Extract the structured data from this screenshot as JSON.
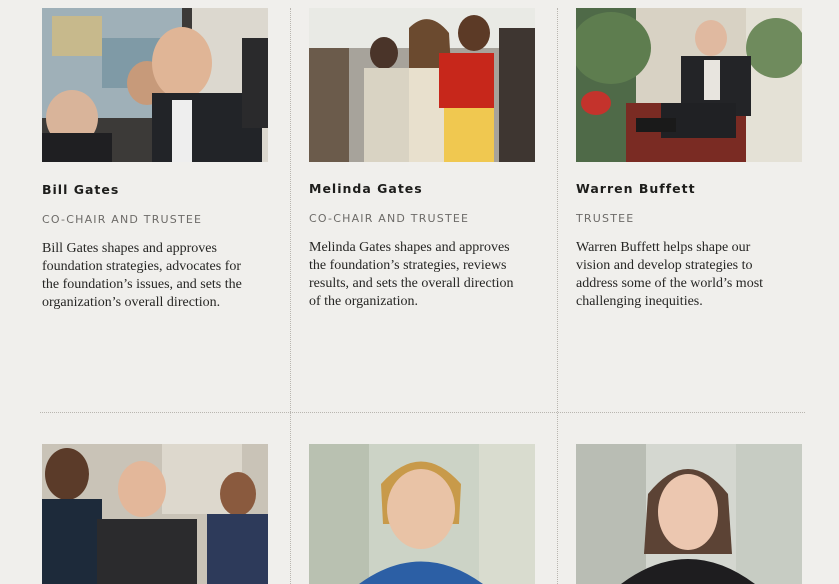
{
  "people": [
    {
      "name": "Bill Gates",
      "role": "CO-CHAIR AND TRUSTEE",
      "description": "Bill Gates shapes and approves foundation strategies, advocates for the foundation’s issues, and sets the organization’s overall direction.",
      "photo_icon": "bill-gates-photo"
    },
    {
      "name": "Melinda Gates",
      "role": "CO-CHAIR AND TRUSTEE",
      "description": "Melinda Gates shapes and approves the foundation’s strategies, reviews results, and sets the overall direction of the organization.",
      "photo_icon": "melinda-gates-photo"
    },
    {
      "name": "Warren Buffett",
      "role": "TRUSTEE",
      "description": "Warren Buffett helps shape our vision and develop strategies to address some of the world’s most challenging inequities.",
      "photo_icon": "warren-buffett-photo"
    }
  ],
  "colors": {
    "background": "#f0efec",
    "text": "#262624",
    "role": "#6d6b68",
    "divider": "#b9b6b0"
  }
}
